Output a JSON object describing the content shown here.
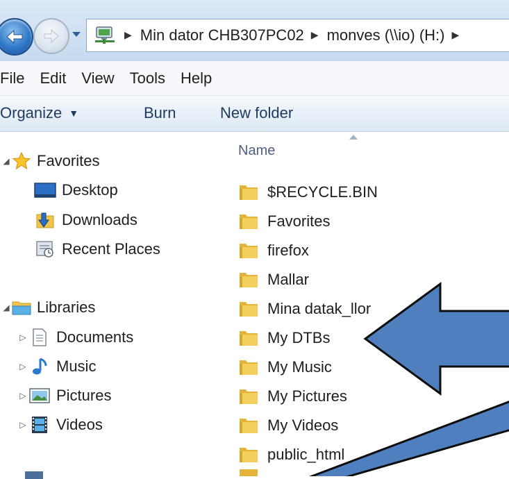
{
  "address_bar": {
    "breadcrumbs": [
      "Min dator CHB307PC02",
      "monves (\\\\io) (H:)"
    ],
    "computer_icon": "network-computer-icon"
  },
  "menu": {
    "items": [
      "File",
      "Edit",
      "View",
      "Tools",
      "Help"
    ]
  },
  "command_bar": {
    "organize": "Organize",
    "burn": "Burn",
    "new_folder": "New folder"
  },
  "nav": {
    "favorites": "Favorites",
    "desktop": "Desktop",
    "downloads": "Downloads",
    "recent_places": "Recent Places",
    "libraries": "Libraries",
    "documents": "Documents",
    "music": "Music",
    "pictures": "Pictures",
    "videos": "Videos"
  },
  "file_list": {
    "column_name": "Name",
    "items": [
      "$RECYCLE.BIN",
      "Favorites",
      "firefox",
      "Mallar",
      "Mina datak_llor",
      "My DTBs",
      "My Music",
      "My Pictures",
      "My Videos",
      "public_html"
    ]
  },
  "colors": {
    "arrow_fill": "#4f7fbf",
    "arrow_stroke": "#0d0d0d",
    "folder": "#f0c64a"
  }
}
